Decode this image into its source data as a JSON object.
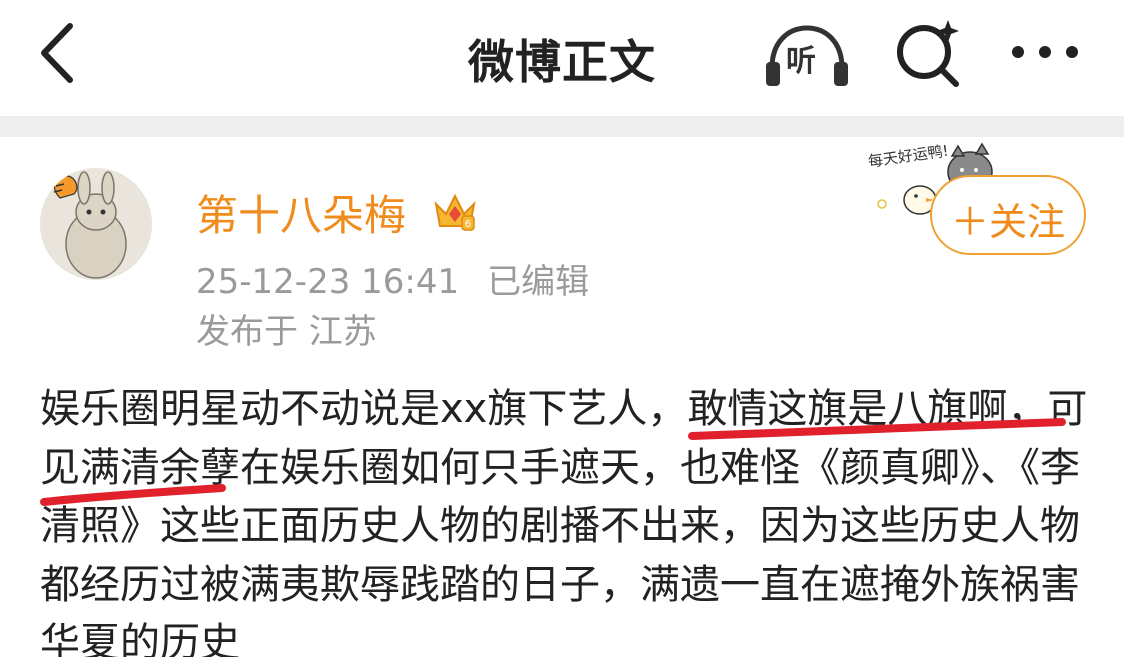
{
  "header": {
    "title": "微博正文",
    "listen_label": "听"
  },
  "post": {
    "author": "第十八朵梅",
    "time": "25-12-23 16:41",
    "edited": "已编辑",
    "location": "发布于 江苏",
    "follow_label": "＋关注",
    "sticker_text": "每天好运鸭!",
    "content": "娱乐圈明星动不动说是xx旗下艺人，敢情这旗是八旗啊，可见满清余孽在娱乐圈如何只手遮天，也难怪《颜真卿》、《李清照》这些正面历史人物的剧播不出来，因为这些历史人物都经历过被满夷欺辱践踏的日子，满遗一直在遮掩外族祸害华夏的历史"
  },
  "colors": {
    "author": "#f08c1e",
    "follow": "#f08a1a",
    "meta": "#9a9a9a",
    "annotation": "#e0202a"
  }
}
